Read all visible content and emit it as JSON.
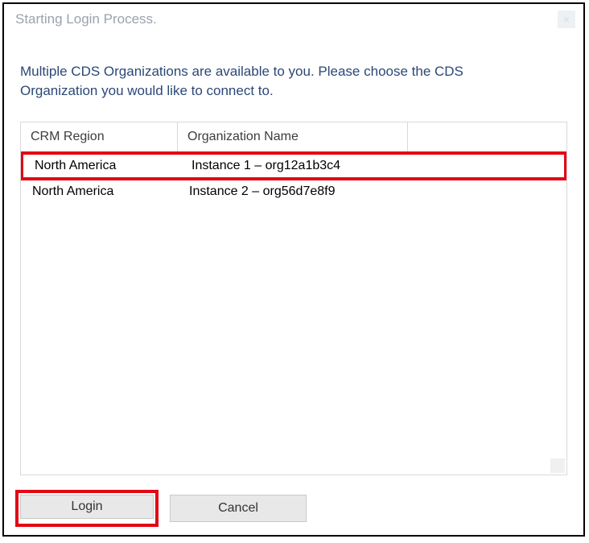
{
  "titlebar": {
    "text": "Starting Login Process."
  },
  "instruction": "Multiple CDS Organizations are available to you. Please choose the CDS Organization you would like to connect to.",
  "table": {
    "headers": {
      "region": "CRM Region",
      "org": "Organization Name"
    },
    "rows": [
      {
        "region": "North America",
        "org": "Instance 1 – org12a1b3c4",
        "highlighted": true
      },
      {
        "region": "North America",
        "org": "Instance 2 – org56d7e8f9",
        "highlighted": false
      }
    ]
  },
  "buttons": {
    "login": "Login",
    "cancel": "Cancel"
  }
}
